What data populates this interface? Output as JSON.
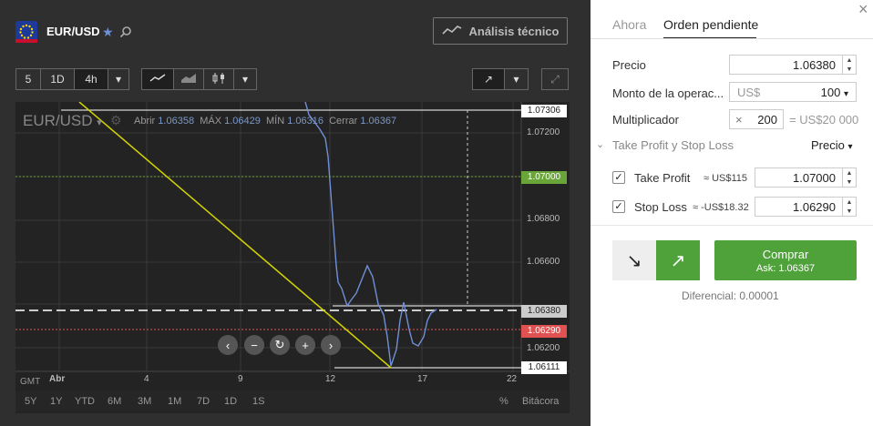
{
  "header": {
    "symbol": "EUR/USD",
    "analysis_button": "Análisis técnico"
  },
  "toolbar": {
    "timeframes": [
      "5",
      "1D",
      "4h"
    ],
    "chart_types": [
      "line-chart-icon",
      "area-chart-icon",
      "candlestick-icon"
    ]
  },
  "chart": {
    "symbol_label": "EUR/USD",
    "ohlc": {
      "open_label": "Abrir",
      "open": "1.06358",
      "high_label": "MÁX",
      "high": "1.06429",
      "low_label": "MÍN",
      "low": "1.06316",
      "close_label": "Cerrar",
      "close": "1.06367"
    },
    "price_ticks": [
      "1.07200",
      "1.06800",
      "1.06600",
      "1.06200"
    ],
    "price_tags": {
      "top": "1.07306",
      "take_profit": "1.07000",
      "current": "1.06380",
      "stop_loss": "1.06290",
      "bottom": "1.06111"
    },
    "time_ticks": [
      "Abr",
      "4",
      "9",
      "12",
      "17",
      "22"
    ],
    "timezone": "GMT",
    "ranges": [
      "5Y",
      "1Y",
      "YTD",
      "6M",
      "3M",
      "1M",
      "7D",
      "1D",
      "1S"
    ],
    "percent_label": "%",
    "log_label": "Bitácora",
    "colors": {
      "take_profit": "#6aa53a",
      "stop_loss": "#e05252",
      "line": "#6f8fd6",
      "trend": "#d4d400"
    }
  },
  "order": {
    "tabs": [
      "Ahora",
      "Orden pendiente"
    ],
    "active_tab": "Orden pendiente",
    "price_label": "Precio",
    "price_value": "1.06380",
    "amount_label": "Monto de la operac...",
    "amount_currency": "US$",
    "amount_value": "100",
    "multiplier_label": "Multiplicador",
    "multiplier_prefix": "×",
    "multiplier_value": "200",
    "multiplier_result": "= US$20 000",
    "tpsl_label": "Take Profit y Stop Loss",
    "tpsl_mode": "Precio",
    "take_profit_label": "Take Profit",
    "take_profit_amount": "≈ US$115",
    "take_profit_value": "1.07000",
    "stop_loss_label": "Stop Loss",
    "stop_loss_amount": "≈ -US$18.32",
    "stop_loss_value": "1.06290",
    "buy_label": "Comprar",
    "buy_ask": "Ask: 1.06367",
    "spread": "Diferencial: 0.00001",
    "accent": "#4fa23a"
  }
}
